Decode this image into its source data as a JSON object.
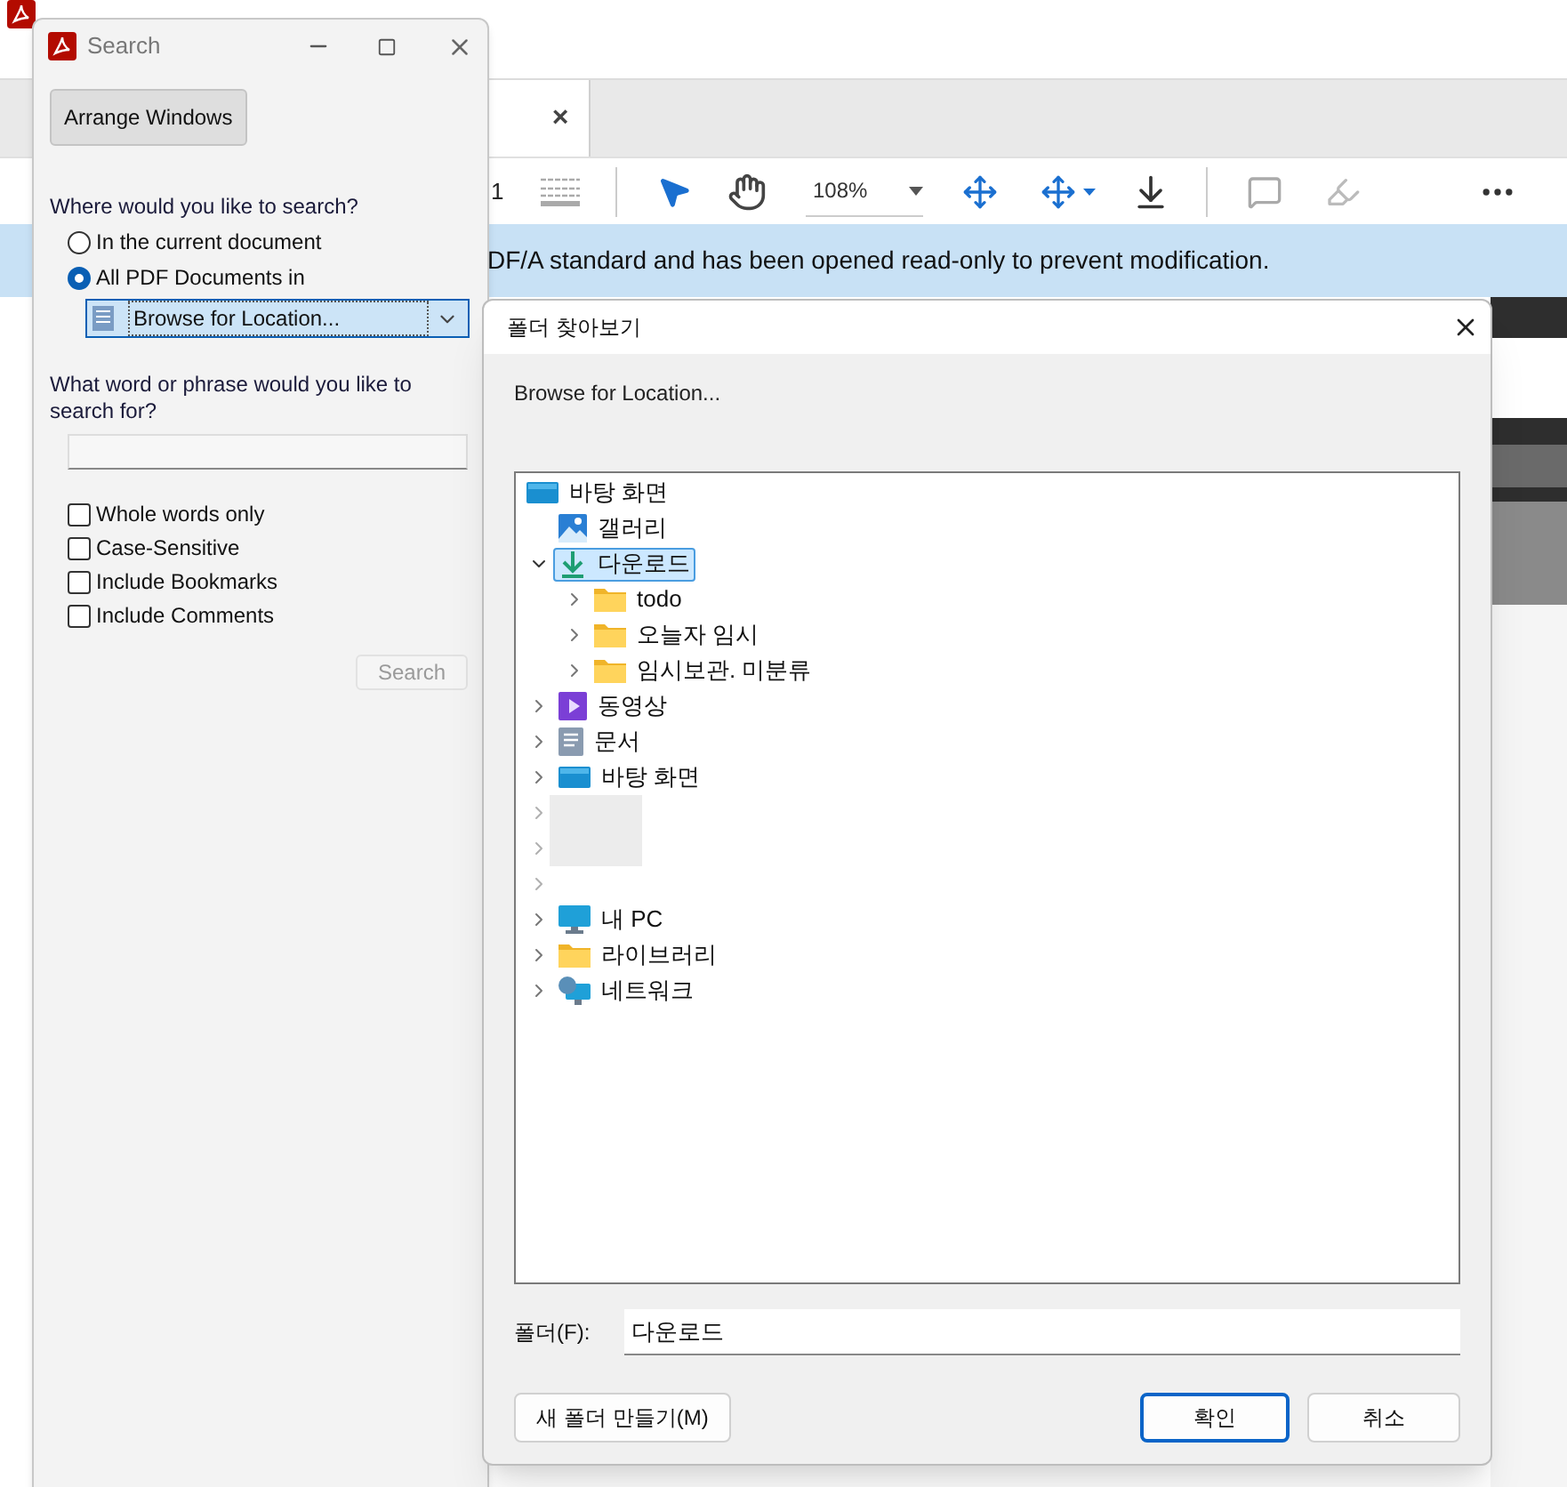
{
  "app": {
    "tab_close": "×",
    "page_number": "1",
    "zoom": "108%",
    "banner": "DF/A standard and has been opened read-only to prevent modification."
  },
  "search_window": {
    "title": "Search",
    "arrange_button": "Arrange Windows",
    "where_label": "Where would you like to search?",
    "scopes": [
      {
        "label": "In the current document",
        "selected": false
      },
      {
        "label": "All PDF Documents in",
        "selected": true
      }
    ],
    "location": "Browse for Location...",
    "phrase_label": "What word or phrase would you like to search for?",
    "options": [
      {
        "label": "Whole words only",
        "checked": false
      },
      {
        "label": "Case-Sensitive",
        "checked": false
      },
      {
        "label": "Include Bookmarks",
        "checked": false
      },
      {
        "label": "Include Comments",
        "checked": false
      }
    ],
    "search_button": {
      "label": "Search",
      "disabled": true
    }
  },
  "folder_dialog": {
    "title": "폴더 찾아보기",
    "description": "Browse for Location...",
    "tree": [
      {
        "label": "바탕 화면",
        "kind": "desktop",
        "selected": false,
        "children": [
          {
            "label": "갤러리",
            "kind": "gallery",
            "selected": false
          },
          {
            "label": "다운로드",
            "kind": "download",
            "expanded": true,
            "selected": true,
            "children": [
              {
                "label": "todo",
                "kind": "folder",
                "expanded": false,
                "selected": false
              },
              {
                "label": "오늘자 임시",
                "kind": "folder",
                "expanded": false,
                "selected": false
              },
              {
                "label": "임시보관. 미분류",
                "kind": "folder",
                "expanded": false,
                "selected": false
              }
            ]
          },
          {
            "label": "동영상",
            "kind": "video",
            "expanded": false,
            "selected": false
          },
          {
            "label": "문서",
            "kind": "document",
            "expanded": false,
            "selected": false
          },
          {
            "label": "바탕 화면",
            "kind": "desktop",
            "expanded": false,
            "selected": false
          },
          {
            "kind": "redacted"
          },
          {
            "kind": "redacted"
          },
          {
            "kind": "redacted"
          },
          {
            "label": "내 PC",
            "kind": "pc",
            "expanded": false,
            "selected": false
          },
          {
            "label": "라이브러리",
            "kind": "folder",
            "expanded": false,
            "selected": false
          },
          {
            "label": "네트워크",
            "kind": "network",
            "expanded": false,
            "selected": false
          }
        ]
      }
    ],
    "folder_label": "폴더(F):",
    "folder_value": "다운로드",
    "buttons": [
      {
        "label": "새 폴더 만들기(M)",
        "kind": "new-folder",
        "focused": false
      },
      {
        "label": "확인",
        "kind": "ok",
        "focused": true
      },
      {
        "label": "취소",
        "kind": "cancel",
        "focused": false
      }
    ]
  }
}
